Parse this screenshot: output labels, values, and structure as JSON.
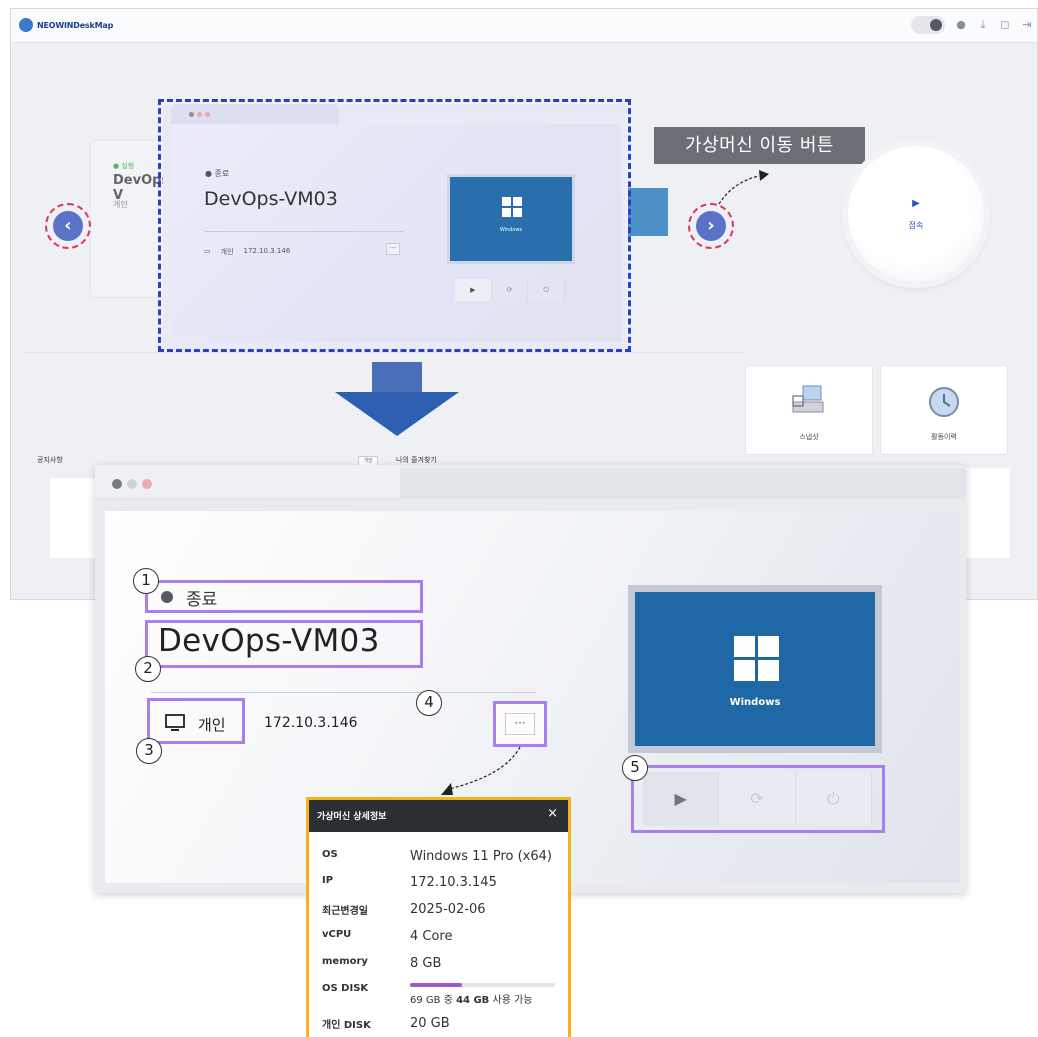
{
  "app": {
    "logo_text": "NEOWINDeskMap"
  },
  "carousel": {
    "prev_card": {
      "status": "● 실행",
      "name": "DevOps-V",
      "meta": "개인"
    },
    "selected_card": {
      "status": "● 종료",
      "name": "DevOps-VM03",
      "owner": "개인",
      "ip": "172.10.3.146",
      "more": "···",
      "thumb_label": "Windows"
    },
    "callout": "가상머신 이동 버튼",
    "prev_icon": "chevron-left-icon",
    "next_icon": "chevron-right-icon",
    "connect": {
      "play": "▶",
      "label": "접속"
    }
  },
  "tiles": [
    {
      "label": "스냅샷",
      "icon": "snapshot-icon"
    },
    {
      "label": "활동이력",
      "icon": "history-icon"
    }
  ],
  "sections": {
    "notice": "공지사항",
    "my_list_tag": "개발",
    "my_list": "나의 즐겨찾기"
  },
  "detail": {
    "status": "종료",
    "name": "DevOps-VM03",
    "owner": "개인",
    "ip": "172.10.3.146",
    "more": "···",
    "thumb_label": "Windows",
    "badges": [
      "1",
      "2",
      "3",
      "4",
      "5"
    ],
    "controls": [
      "▶",
      "⟳",
      "⏻"
    ]
  },
  "popup": {
    "title": "가상머신 상세정보",
    "close": "×",
    "rows": [
      {
        "key": "OS",
        "value": "Windows 11 Pro (x64)"
      },
      {
        "key": "IP",
        "value": "172.10.3.145"
      },
      {
        "key": "최근변경일",
        "value": "2025-02-06"
      },
      {
        "key": "vCPU",
        "value": "4 Core"
      },
      {
        "key": "memory",
        "value": "8 GB"
      },
      {
        "key": "OS DISK",
        "value": ""
      },
      {
        "key": "개인 DISK",
        "value": "20 GB"
      }
    ],
    "os_disk": {
      "total": "69 GB 중 ",
      "free": "44 GB",
      "suffix": " 사용 가능",
      "used_fraction": 0.36
    }
  },
  "colors": {
    "highlight_box": "#a97ff0",
    "dashed_selection": "#2640c8",
    "nav_ring": "#e0336c",
    "popup_border": "#f2b21a",
    "windows_blue": "#1f68a5"
  }
}
